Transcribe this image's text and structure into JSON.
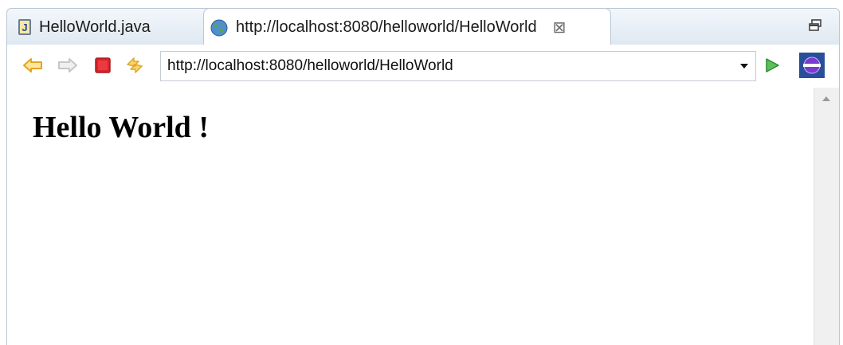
{
  "tabs": [
    {
      "label": "HelloWorld.java",
      "icon": "java-file-icon"
    },
    {
      "label": "http://localhost:8080/helloworld/HelloWorld",
      "icon": "globe-icon",
      "active": true
    }
  ],
  "toolbar": {
    "url": "http://localhost:8080/helloworld/HelloWorld"
  },
  "page": {
    "heading": "Hello World !"
  },
  "colors": {
    "tab_border": "#b9c7d6",
    "back_arrow": "#f2b632",
    "stop": "#d9232a",
    "go": "#3aa840",
    "eclipse_bg": "#2a4f9a"
  }
}
